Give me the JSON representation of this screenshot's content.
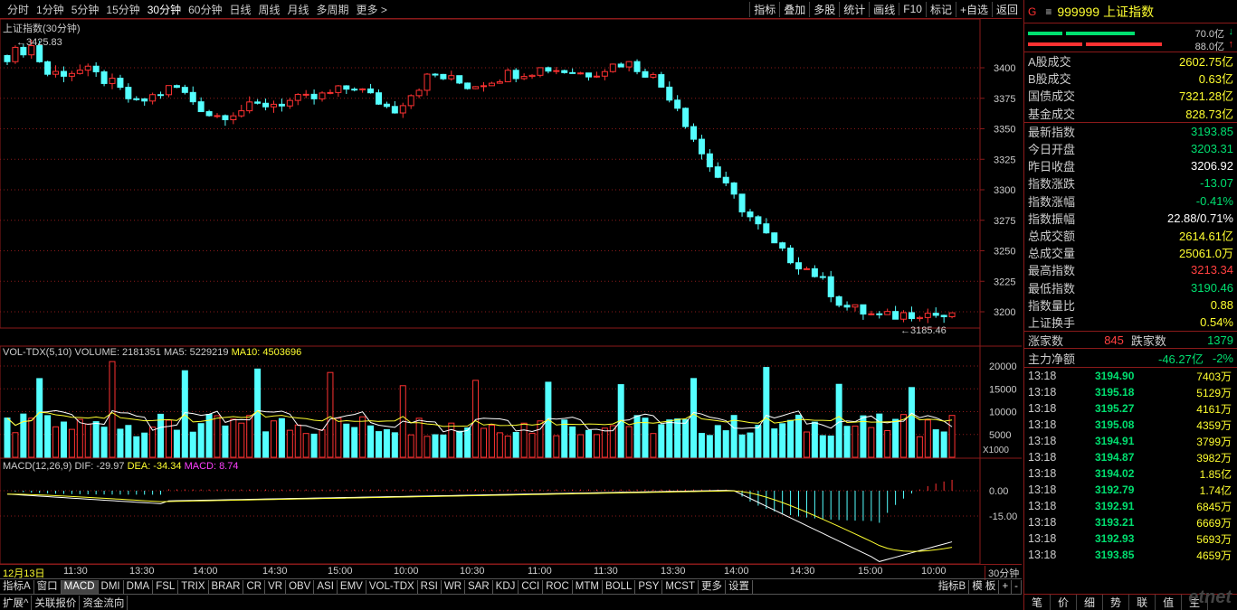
{
  "toolbar": {
    "periods": [
      "分时",
      "1分钟",
      "5分钟",
      "15分钟",
      "30分钟",
      "60分钟",
      "日线",
      "周线",
      "月线",
      "多周期",
      "更多 >"
    ],
    "active_period": "30分钟",
    "tools": [
      "指标",
      "叠加",
      "多股",
      "统计",
      "画线",
      "F10",
      "标记",
      "+自选",
      "返回"
    ]
  },
  "main_chart": {
    "title": "上证指数(30分钟)",
    "high_label": "3425.83",
    "low_label": "3185.46",
    "y_ticks": [
      "3400",
      "3375",
      "3350",
      "3325",
      "3300",
      "3275",
      "3250",
      "3225",
      "3200"
    ]
  },
  "volume_panel": {
    "name": "VOL-TDX(5,10)",
    "volume_label": "VOLUME: 2181351",
    "ma5_label": "MA5: 5229219",
    "ma10_label": "MA10: 4503696",
    "y_ticks": [
      "20000",
      "15000",
      "10000",
      "5000"
    ],
    "unit": "X1000"
  },
  "macd_panel": {
    "name": "MACD(12,26,9)",
    "dif_label": "DIF: -29.97",
    "dea_label": "DEA: -34.34",
    "macd_label": "MACD: 8.74",
    "y_ticks": [
      "0.00",
      "-15.00"
    ]
  },
  "time_axis": {
    "labels": [
      "12月13日",
      "11:30",
      "13:30",
      "14:00",
      "14:30",
      "15:00",
      "10:00",
      "10:30",
      "11:00",
      "11:30",
      "13:30",
      "14:00",
      "14:30",
      "15:00",
      "10:00"
    ],
    "period": "30分钟"
  },
  "indicator_tabs": [
    "指标A",
    "窗口",
    "MACD",
    "DMI",
    "DMA",
    "FSL",
    "TRIX",
    "BRAR",
    "CR",
    "VR",
    "OBV",
    "ASI",
    "EMV",
    "VOL-TDX",
    "RSI",
    "WR",
    "SAR",
    "KDJ",
    "CCI",
    "ROC",
    "MTM",
    "BOLL",
    "PSY",
    "MCST",
    "更多",
    "设置"
  ],
  "active_indicator": "MACD",
  "indicator_right": [
    "指标B",
    "模 板",
    "+",
    "-"
  ],
  "bottom_tabs": [
    "扩展^",
    "关联报价",
    "资金流向"
  ],
  "quote": {
    "g": "G",
    "code": "999999",
    "name": "上证指数",
    "up_ratio": "70.0亿",
    "down_ratio": "88.0亿",
    "fields": [
      {
        "label": "A股成交",
        "value": "2602.75亿",
        "color": "#ffff30"
      },
      {
        "label": "B股成交",
        "value": "0.63亿",
        "color": "#ffff30"
      },
      {
        "label": "国债成交",
        "value": "7321.28亿",
        "color": "#ffff30"
      },
      {
        "label": "基金成交",
        "value": "828.73亿",
        "color": "#ffff30"
      }
    ],
    "stats": [
      {
        "label": "最新指数",
        "value": "3193.85",
        "color": "#00e070"
      },
      {
        "label": "今日开盘",
        "value": "3203.31",
        "color": "#00e070"
      },
      {
        "label": "昨日收盘",
        "value": "3206.92",
        "color": "#ffffff"
      },
      {
        "label": "指数涨跌",
        "value": "-13.07",
        "color": "#00e070"
      },
      {
        "label": "指数涨幅",
        "value": "-0.41%",
        "color": "#00e070"
      },
      {
        "label": "指数振幅",
        "value": "22.88/0.71%",
        "color": "#ffffff"
      },
      {
        "label": "总成交额",
        "value": "2614.61亿",
        "color": "#ffff30"
      },
      {
        "label": "总成交量",
        "value": "25061.0万",
        "color": "#ffff30"
      },
      {
        "label": "最高指数",
        "value": "3213.34",
        "color": "#ff4040"
      },
      {
        "label": "最低指数",
        "value": "3190.46",
        "color": "#00e070"
      },
      {
        "label": "指数量比",
        "value": "0.88",
        "color": "#ffff30"
      },
      {
        "label": "上证换手",
        "value": "0.54%",
        "color": "#ffff30"
      }
    ],
    "rise_label": "涨家数",
    "rise_value": "845",
    "fall_label": "跌家数",
    "fall_value": "1379",
    "flow_label": "主力净额",
    "flow_value": "-46.27亿",
    "flow_pct": "-2%"
  },
  "ticks": [
    {
      "time": "13:18",
      "price": "3194.90",
      "vol": "7403万"
    },
    {
      "time": "13:18",
      "price": "3195.18",
      "vol": "5129万"
    },
    {
      "time": "13:18",
      "price": "3195.27",
      "vol": "4161万"
    },
    {
      "time": "13:18",
      "price": "3195.08",
      "vol": "4359万"
    },
    {
      "time": "13:18",
      "price": "3194.91",
      "vol": "3799万"
    },
    {
      "time": "13:18",
      "price": "3194.87",
      "vol": "3982万"
    },
    {
      "time": "13:18",
      "price": "3194.02",
      "vol": "1.85亿"
    },
    {
      "time": "13:18",
      "price": "3192.79",
      "vol": "1.74亿"
    },
    {
      "time": "13:18",
      "price": "3192.91",
      "vol": "6845万"
    },
    {
      "time": "13:18",
      "price": "3193.21",
      "vol": "6669万"
    },
    {
      "time": "13:18",
      "price": "3192.93",
      "vol": "5693万"
    },
    {
      "time": "13:18",
      "price": "3193.85",
      "vol": "4659万"
    }
  ],
  "side_tabs": [
    "笔",
    "价",
    "细",
    "势",
    "联",
    "值",
    "主"
  ],
  "watermark": "etnet",
  "colors": {
    "up": "#ff3232",
    "down": "#54ffff",
    "grid": "#8b1a1a",
    "dif": "#ffffff",
    "dea": "#ffff30",
    "macd": "#ff40ff"
  }
}
